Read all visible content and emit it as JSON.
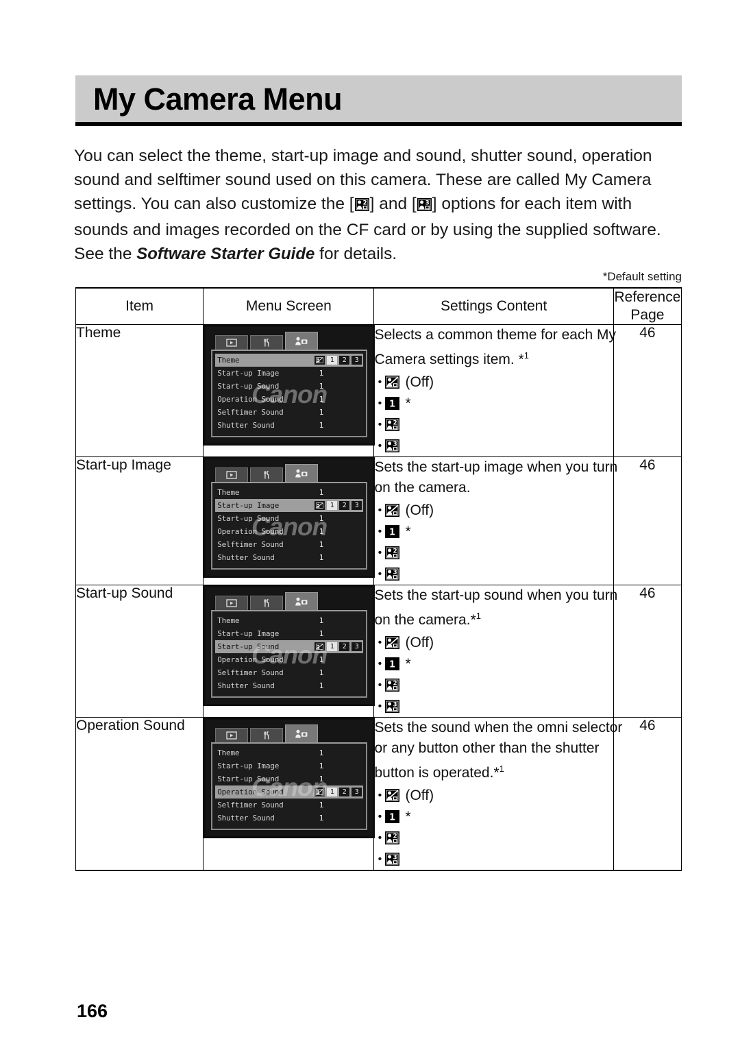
{
  "header": {
    "title": "My Camera Menu"
  },
  "intro": {
    "part1": "You can select the theme, start-up image and sound, shutter sound, operation sound and selftimer sound used on this camera. These are called My Camera settings. You can also customize the [",
    "part2": "] and [",
    "part3": "] options for each item with sounds and images recorded on the CF card or by using the supplied software. See the ",
    "italic": "Software Starter Guide",
    "part4": " for details.",
    "icon_a": "my-camera-2-icon",
    "icon_b": "my-camera-3-icon"
  },
  "default_note": "*Default setting",
  "table": {
    "headers": [
      "Item",
      "Menu Screen",
      "Settings Content",
      "Reference Page"
    ],
    "rows": [
      {
        "item": "Theme",
        "desc_lines": [
          "Selects a common theme for each My",
          "Camera settings item. *1"
        ],
        "desc_sup": "1",
        "options": [
          {
            "icon": "my-camera-off-icon",
            "label": "(Off)"
          },
          {
            "icon": "my-camera-1-icon",
            "label": "*"
          },
          {
            "icon": "my-camera-2-icon",
            "label": ""
          },
          {
            "icon": "my-camera-3-icon",
            "label": ""
          }
        ],
        "reference_page": "46",
        "menu_screen": {
          "tabs": [
            "playback-tab-icon",
            "setup-tab-icon",
            "my-camera-tab-icon"
          ],
          "active_tab": 2,
          "selected_index": 0,
          "items": [
            {
              "label": "Theme",
              "value": "1"
            },
            {
              "label": "Start-up Image",
              "value": "1"
            },
            {
              "label": "Start-up Sound",
              "value": "1"
            },
            {
              "label": "Operation Sound",
              "value": "1"
            },
            {
              "label": "Selftimer Sound",
              "value": "1"
            },
            {
              "label": "Shutter Sound",
              "value": "1"
            }
          ],
          "selected_options": [
            "off",
            "1",
            "2",
            "3"
          ],
          "selected_value": "1",
          "watermark": "Canon"
        }
      },
      {
        "item": "Start-up Image",
        "desc_lines": [
          "Sets the start-up image when you turn",
          "on the camera."
        ],
        "desc_sup": "",
        "options": [
          {
            "icon": "my-camera-off-icon",
            "label": "(Off)"
          },
          {
            "icon": "my-camera-1-icon",
            "label": "*"
          },
          {
            "icon": "my-camera-2-icon",
            "label": ""
          },
          {
            "icon": "my-camera-3-icon",
            "label": ""
          }
        ],
        "reference_page": "46",
        "menu_screen": {
          "tabs": [
            "playback-tab-icon",
            "setup-tab-icon",
            "my-camera-tab-icon"
          ],
          "active_tab": 2,
          "selected_index": 1,
          "items": [
            {
              "label": "Theme",
              "value": "1"
            },
            {
              "label": "Start-up Image",
              "value": "1"
            },
            {
              "label": "Start-up Sound",
              "value": "1"
            },
            {
              "label": "Operation Sound",
              "value": "1"
            },
            {
              "label": "Selftimer Sound",
              "value": "1"
            },
            {
              "label": "Shutter Sound",
              "value": "1"
            }
          ],
          "selected_options": [
            "off",
            "1",
            "2",
            "3"
          ],
          "selected_value": "1",
          "watermark": "Canon"
        }
      },
      {
        "item": "Start-up Sound",
        "desc_lines": [
          "Sets the start-up sound when you turn",
          "on the camera.*1"
        ],
        "desc_sup": "1",
        "options": [
          {
            "icon": "my-camera-off-icon",
            "label": "(Off)"
          },
          {
            "icon": "my-camera-1-icon",
            "label": "*"
          },
          {
            "icon": "my-camera-2-icon",
            "label": ""
          },
          {
            "icon": "my-camera-3-icon",
            "label": ""
          }
        ],
        "reference_page": "46",
        "menu_screen": {
          "tabs": [
            "playback-tab-icon",
            "setup-tab-icon",
            "my-camera-tab-icon"
          ],
          "active_tab": 2,
          "selected_index": 2,
          "items": [
            {
              "label": "Theme",
              "value": "1"
            },
            {
              "label": "Start-up Image",
              "value": "1"
            },
            {
              "label": "Start-up Sound",
              "value": "1"
            },
            {
              "label": "Operation Sound",
              "value": "1"
            },
            {
              "label": "Selftimer Sound",
              "value": "1"
            },
            {
              "label": "Shutter Sound",
              "value": "1"
            }
          ],
          "selected_options": [
            "off",
            "1",
            "2",
            "3"
          ],
          "selected_value": "1",
          "watermark": "Canon"
        }
      },
      {
        "item": "Operation Sound",
        "desc_lines": [
          "Sets the sound when the omni selector",
          "or any button other than the shutter",
          "button is operated.*1"
        ],
        "desc_sup": "1",
        "options": [
          {
            "icon": "my-camera-off-icon",
            "label": "(Off)"
          },
          {
            "icon": "my-camera-1-icon",
            "label": "*"
          },
          {
            "icon": "my-camera-2-icon",
            "label": ""
          },
          {
            "icon": "my-camera-3-icon",
            "label": ""
          }
        ],
        "reference_page": "46",
        "menu_screen": {
          "tabs": [
            "playback-tab-icon",
            "setup-tab-icon",
            "my-camera-tab-icon"
          ],
          "active_tab": 2,
          "selected_index": 3,
          "items": [
            {
              "label": "Theme",
              "value": "1"
            },
            {
              "label": "Start-up Image",
              "value": "1"
            },
            {
              "label": "Start-up Sound",
              "value": "1"
            },
            {
              "label": "Operation Sound",
              "value": "1"
            },
            {
              "label": "Selftimer Sound",
              "value": "1"
            },
            {
              "label": "Shutter Sound",
              "value": "1"
            }
          ],
          "selected_options": [
            "off",
            "1",
            "2",
            "3"
          ],
          "selected_value": "1",
          "watermark": "Canon"
        }
      }
    ]
  },
  "page_number": "166"
}
